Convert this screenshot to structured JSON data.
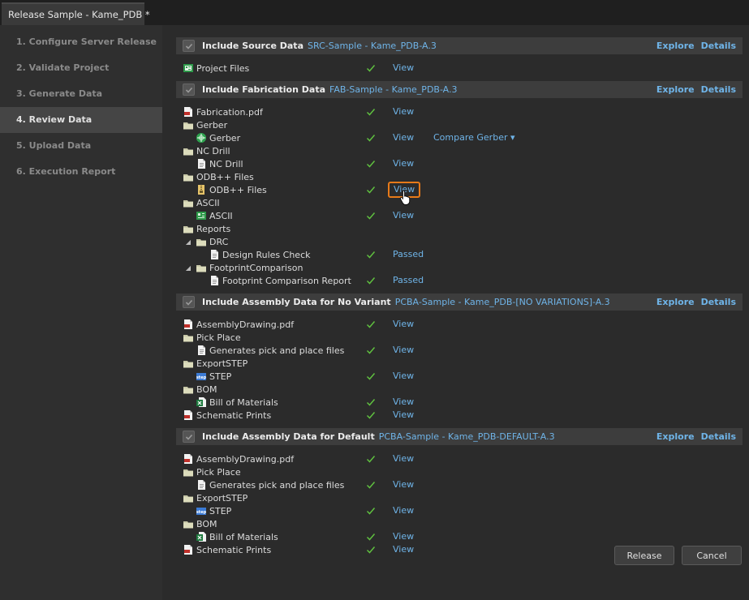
{
  "window": {
    "tab_title": "Release Sample - Kame_PDB *",
    "doc_icon": "pcb-document-icon"
  },
  "steps": [
    {
      "label": "1. Configure Server Release",
      "active": false
    },
    {
      "label": "2. Validate Project",
      "active": false
    },
    {
      "label": "3. Generate Data",
      "active": false
    },
    {
      "label": "4. Review Data",
      "active": true
    },
    {
      "label": "5. Upload Data",
      "active": false
    },
    {
      "label": "6. Execution Report",
      "active": false
    }
  ],
  "actions": {
    "explore": "Explore",
    "details": "Details"
  },
  "sections": [
    {
      "title": "Include Source Data",
      "id": "SRC-Sample - Kame_PDB-A.3",
      "rows": [
        {
          "label": "Project Files",
          "icon": "project-files-icon",
          "level": 0,
          "ok": true,
          "action": "View"
        }
      ]
    },
    {
      "title": "Include Fabrication Data",
      "id": "FAB-Sample - Kame_PDB-A.3",
      "rows": [
        {
          "label": "Fabrication.pdf",
          "icon": "pdf-icon",
          "level": 0,
          "ok": true,
          "action": "View"
        },
        {
          "label": "Gerber",
          "icon": "folder-icon",
          "level": 0,
          "ok": false,
          "action": ""
        },
        {
          "label": "Gerber",
          "icon": "gerber-icon",
          "level": 1,
          "ok": true,
          "action": "View",
          "extra": "Compare Gerber ▾"
        },
        {
          "label": "NC Drill",
          "icon": "folder-icon",
          "level": 0,
          "ok": false,
          "action": ""
        },
        {
          "label": "NC Drill",
          "icon": "file-icon",
          "level": 1,
          "ok": true,
          "action": "View"
        },
        {
          "label": "ODB++ Files",
          "icon": "folder-icon",
          "level": 0,
          "ok": false,
          "action": ""
        },
        {
          "label": "ODB++ Files",
          "icon": "archive-icon",
          "level": 1,
          "ok": true,
          "action": "View",
          "highlight": true
        },
        {
          "label": "ASCII",
          "icon": "folder-icon",
          "level": 0,
          "ok": false,
          "action": ""
        },
        {
          "label": "ASCII",
          "icon": "pcb-icon",
          "level": 1,
          "ok": true,
          "action": "View"
        },
        {
          "label": "Reports",
          "icon": "folder-icon",
          "level": 0,
          "ok": false,
          "action": ""
        },
        {
          "label": "DRC",
          "icon": "folder-icon",
          "level": 1,
          "expander": true,
          "ok": false,
          "action": ""
        },
        {
          "label": "Design Rules Check",
          "icon": "file-icon",
          "level": 2,
          "ok": true,
          "action": "Passed"
        },
        {
          "label": "FootprintComparison",
          "icon": "folder-icon",
          "level": 1,
          "expander": true,
          "ok": false,
          "action": ""
        },
        {
          "label": "Footprint Comparison Report",
          "icon": "file-icon",
          "level": 2,
          "ok": true,
          "action": "Passed"
        }
      ]
    },
    {
      "title": "Include Assembly Data for No Variant",
      "id": "PCBA-Sample - Kame_PDB-[NO VARIATIONS]-A.3",
      "rows": [
        {
          "label": "AssemblyDrawing.pdf",
          "icon": "pdf-icon",
          "level": 0,
          "ok": true,
          "action": "View"
        },
        {
          "label": "Pick Place",
          "icon": "folder-icon",
          "level": 0,
          "ok": false,
          "action": ""
        },
        {
          "label": "Generates pick and place files",
          "icon": "file-icon",
          "level": 1,
          "ok": true,
          "action": "View"
        },
        {
          "label": "ExportSTEP",
          "icon": "folder-icon",
          "level": 0,
          "ok": false,
          "action": ""
        },
        {
          "label": "STEP",
          "icon": "step-icon",
          "level": 1,
          "ok": true,
          "action": "View"
        },
        {
          "label": "BOM",
          "icon": "folder-icon",
          "level": 0,
          "ok": false,
          "action": ""
        },
        {
          "label": "Bill of Materials",
          "icon": "excel-icon",
          "level": 1,
          "ok": true,
          "action": "View"
        },
        {
          "label": "Schematic Prints",
          "icon": "pdf-icon",
          "level": 0,
          "ok": true,
          "action": "View"
        }
      ]
    },
    {
      "title": "Include Assembly Data for Default",
      "id": "PCBA-Sample - Kame_PDB-DEFAULT-A.3",
      "rows": [
        {
          "label": "AssemblyDrawing.pdf",
          "icon": "pdf-icon",
          "level": 0,
          "ok": true,
          "action": "View"
        },
        {
          "label": "Pick Place",
          "icon": "folder-icon",
          "level": 0,
          "ok": false,
          "action": ""
        },
        {
          "label": "Generates pick and place files",
          "icon": "file-icon",
          "level": 1,
          "ok": true,
          "action": "View"
        },
        {
          "label": "ExportSTEP",
          "icon": "folder-icon",
          "level": 0,
          "ok": false,
          "action": ""
        },
        {
          "label": "STEP",
          "icon": "step-icon",
          "level": 1,
          "ok": true,
          "action": "View"
        },
        {
          "label": "BOM",
          "icon": "folder-icon",
          "level": 0,
          "ok": false,
          "action": ""
        },
        {
          "label": "Bill of Materials",
          "icon": "excel-icon",
          "level": 1,
          "ok": true,
          "action": "View"
        },
        {
          "label": "Schematic Prints",
          "icon": "pdf-icon",
          "level": 0,
          "ok": true,
          "action": "View"
        }
      ]
    }
  ],
  "buttons": {
    "release": "Release",
    "cancel": "Cancel"
  },
  "colors": {
    "accent": "#6fb4e8",
    "ok_green": "#5fbf3f",
    "highlight": "#e77a19"
  }
}
